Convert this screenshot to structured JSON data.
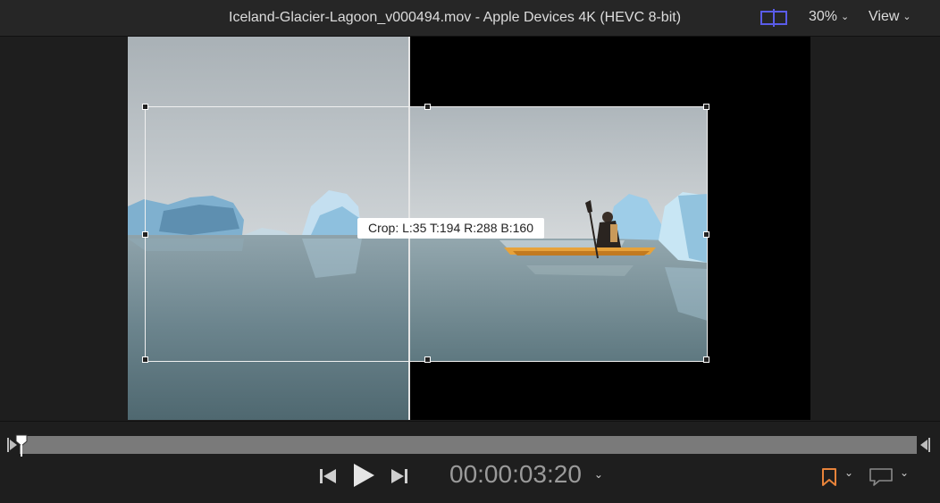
{
  "window": {
    "title": "Iceland-Glacier-Lagoon_v000494.mov - Apple Devices 4K (HEVC 8-bit)",
    "zoom_label": "30%",
    "view_label": "View"
  },
  "viewer": {
    "crop_label": "Crop: L:35 T:194 R:288 B:160"
  },
  "transport": {
    "timecode": "00:00:03:20"
  },
  "icons": {
    "split": "split-view-icon",
    "prev": "go-to-start-icon",
    "play": "play-icon",
    "next": "go-to-end-icon",
    "marker": "bookmark-icon",
    "comment": "comment-icon"
  },
  "colors": {
    "accent_blue": "#5a5ce8",
    "marker_orange": "#e8833a",
    "crop_border": "#f0f0f0"
  }
}
